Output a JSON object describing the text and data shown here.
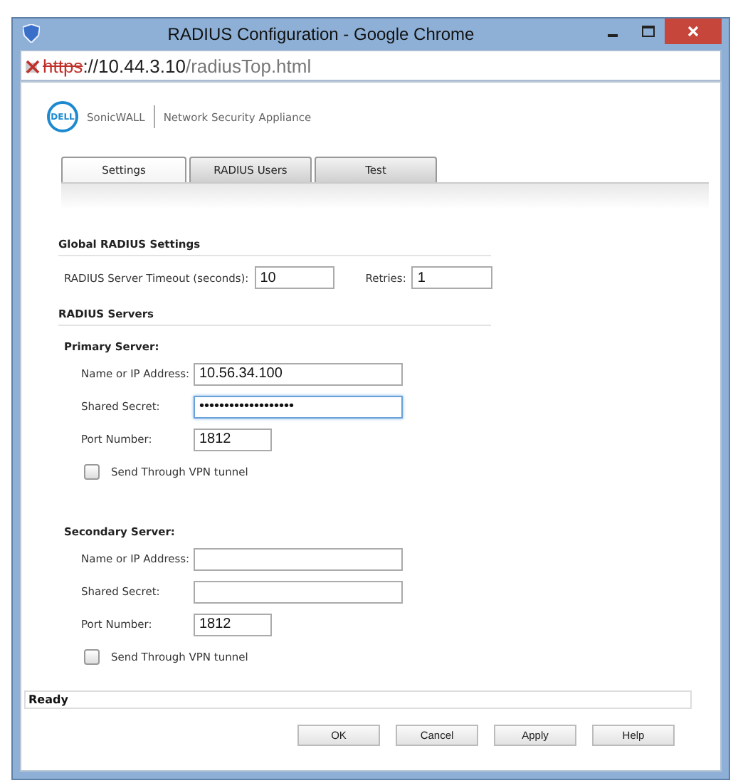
{
  "window": {
    "title": "RADIUS Configuration - Google Chrome"
  },
  "address": {
    "scheme": "https",
    "host": "://10.44.3.10",
    "path": "/radiusTop.html",
    "insecure": true
  },
  "brand": {
    "logo": "DELL",
    "product": "SonicWALL",
    "subtitle": "Network Security Appliance"
  },
  "tabs": [
    {
      "label": "Settings",
      "selected": true
    },
    {
      "label": "RADIUS Users",
      "selected": false
    },
    {
      "label": "Test",
      "selected": false
    }
  ],
  "global": {
    "heading": "Global RADIUS Settings",
    "timeout_label": "RADIUS Server Timeout (seconds):",
    "timeout": "10",
    "retries_label": "Retries:",
    "retries": "1"
  },
  "servers_heading": "RADIUS Servers",
  "servers": [
    {
      "heading": "Primary Server:",
      "fields": [
        {
          "kind": "text",
          "label": "Name or IP Address:",
          "value": "10.56.34.100",
          "focused": false
        },
        {
          "kind": "text",
          "label": "Shared Secret:",
          "value": "•••••••••••••••••••",
          "focused": true
        },
        {
          "kind": "port",
          "label": "Port Number:",
          "value": "1812",
          "focused": false
        }
      ],
      "vpn_label": "Send Through VPN tunnel",
      "vpn_checked": false
    },
    {
      "heading": "Secondary Server:",
      "fields": [
        {
          "kind": "text",
          "label": "Name or IP Address:",
          "focused": false
        },
        {
          "kind": "text",
          "label": "Shared Secret:",
          "focused": false
        },
        {
          "kind": "port",
          "label": "Port Number:",
          "value": "1812",
          "focused": false
        }
      ],
      "vpn_label": "Send Through VPN tunnel",
      "vpn_checked": false
    }
  ],
  "status": "Ready",
  "buttons": [
    "OK",
    "Cancel",
    "Apply",
    "Help"
  ]
}
